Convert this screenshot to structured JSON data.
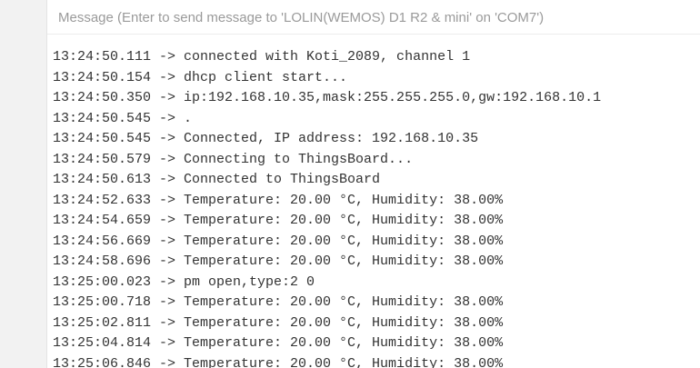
{
  "message_bar": {
    "placeholder": "Message (Enter to send message to 'LOLIN(WEMOS) D1 R2 & mini' on 'COM7')"
  },
  "output": {
    "lines": [
      "13:24:50.111 -> connected with Koti_2089, channel 1",
      "13:24:50.154 -> dhcp client start...",
      "13:24:50.350 -> ip:192.168.10.35,mask:255.255.255.0,gw:192.168.10.1",
      "13:24:50.545 -> .",
      "13:24:50.545 -> Connected, IP address: 192.168.10.35",
      "13:24:50.579 -> Connecting to ThingsBoard...",
      "13:24:50.613 -> Connected to ThingsBoard",
      "13:24:52.633 -> Temperature: 20.00 °C, Humidity: 38.00%",
      "13:24:54.659 -> Temperature: 20.00 °C, Humidity: 38.00%",
      "13:24:56.669 -> Temperature: 20.00 °C, Humidity: 38.00%",
      "13:24:58.696 -> Temperature: 20.00 °C, Humidity: 38.00%",
      "13:25:00.023 -> pm open,type:2 0",
      "13:25:00.718 -> Temperature: 20.00 °C, Humidity: 38.00%",
      "13:25:02.811 -> Temperature: 20.00 °C, Humidity: 38.00%",
      "13:25:04.814 -> Temperature: 20.00 °C, Humidity: 38.00%",
      "13:25:06.846 -> Temperature: 20.00 °C, Humidity: 38.00%"
    ]
  }
}
